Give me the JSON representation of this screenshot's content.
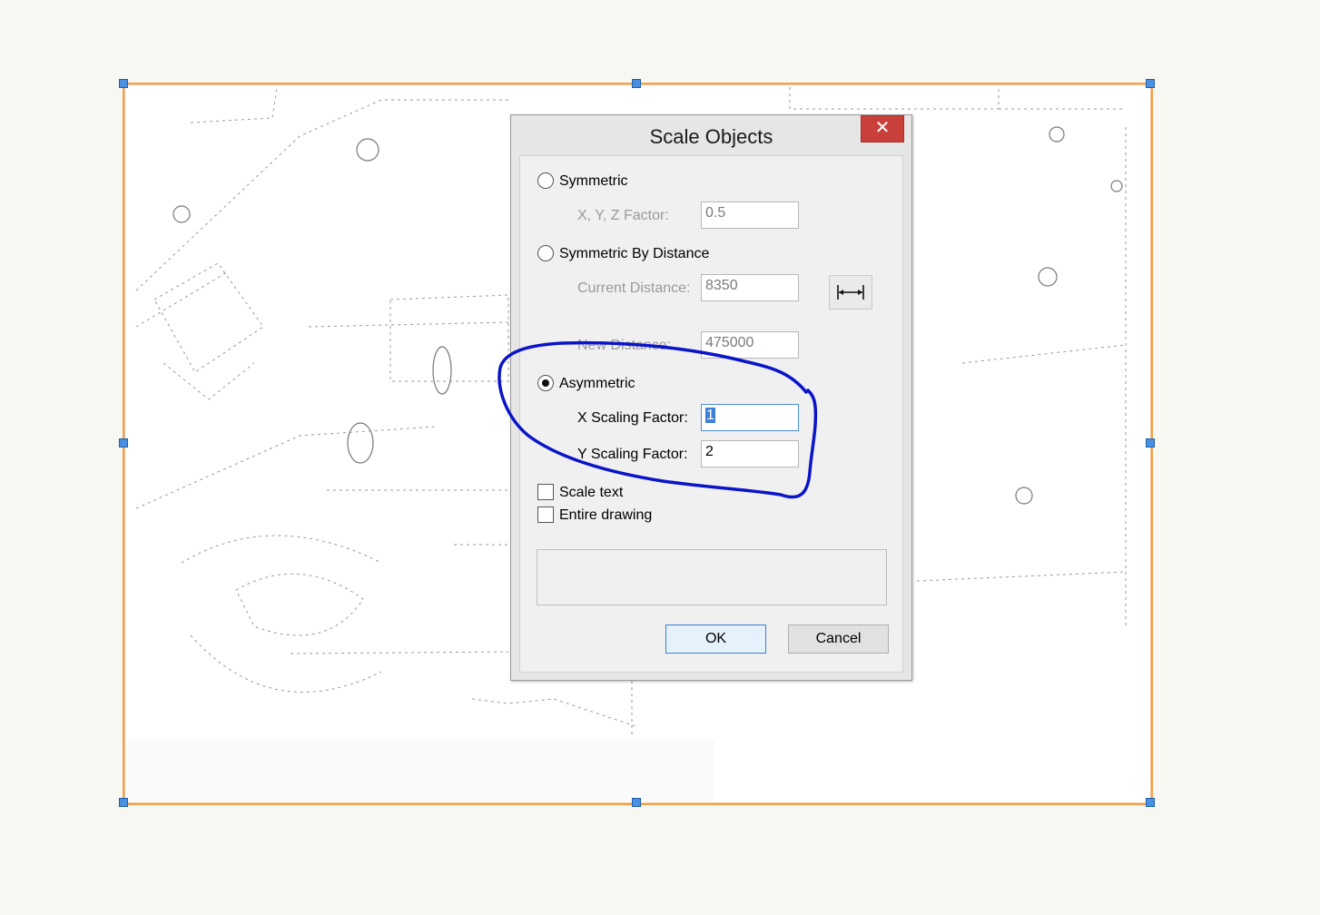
{
  "dialog": {
    "title": "Scale Objects",
    "close_glyph": "✕",
    "symmetric": {
      "label": "Symmetric",
      "factor_label": "X, Y, Z Factor:",
      "factor_value": "0.5"
    },
    "symmetric_by_distance": {
      "label": "Symmetric By Distance",
      "current_label": "Current Distance:",
      "current_value": "8350",
      "new_label": "New Distance:",
      "new_value": "475000",
      "measure_icon": "measure-distance-icon"
    },
    "asymmetric": {
      "label": "Asymmetric",
      "x_label": "X Scaling Factor:",
      "x_value": "1",
      "y_label": "Y Scaling Factor:",
      "y_value": "2"
    },
    "scale_text": {
      "label": "Scale text",
      "checked": false
    },
    "entire_drawing": {
      "label": "Entire drawing",
      "checked": false
    },
    "selected_option": "asymmetric",
    "ok_label": "OK",
    "cancel_label": "Cancel"
  },
  "colors": {
    "selection_border": "#f0a050",
    "handle": "#4a90e2",
    "annotation_ink": "#0a14c8",
    "close_button": "#c9403a"
  }
}
